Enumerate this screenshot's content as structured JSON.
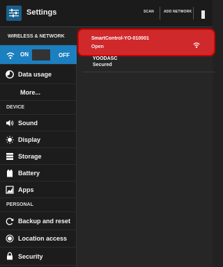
{
  "actionbar": {
    "title": "Settings",
    "scan": "SCAN",
    "add_network": "ADD NETWORK"
  },
  "nav": {
    "wireless_header": "WIRELESS & NETWORK",
    "wifi_on": "ON",
    "wifi_off": "OFF",
    "data_usage": "Data usage",
    "more": "More...",
    "device_header": "DEVICE",
    "sound": "Sound",
    "display": "Display",
    "storage": "Storage",
    "battery": "Battery",
    "apps": "Apps",
    "personal_header": "PERSONAL",
    "backup": "Backup and reset",
    "location": "Location access",
    "security": "Security"
  },
  "networks": [
    {
      "name": "SmartControl-YO-010001",
      "status": "Open"
    },
    {
      "name": "YOODASC",
      "status": "Secured"
    }
  ],
  "colors": {
    "accent": "#1c7fbf",
    "highlight": "#d0292c"
  }
}
